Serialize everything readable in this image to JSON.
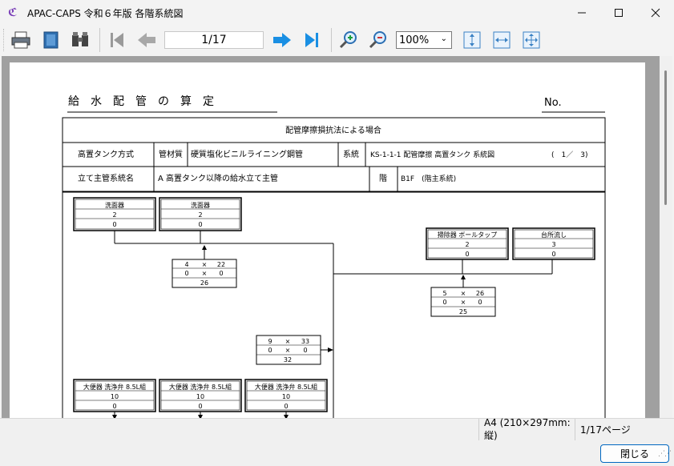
{
  "window": {
    "title": "APAC-CAPS 令和６年版 各階系統図",
    "controls": [
      "minimize-icon",
      "maximize-icon",
      "close-icon"
    ]
  },
  "toolbar": {
    "icons": [
      "print-icon",
      "book-icon",
      "binoculars-icon",
      "first-page-icon",
      "prev-page-icon",
      "next-page-icon",
      "last-page-icon",
      "zoom-in-icon",
      "zoom-out-icon",
      "fit-height-icon",
      "fit-width-icon",
      "fit-page-icon"
    ],
    "page_indicator": "1/17",
    "zoom": "100%"
  },
  "document": {
    "title": "給　水　配　管　の　算　定",
    "no_label": "No.",
    "header_row1": "配管摩擦損抗法による場合",
    "row2": {
      "c1": "高置タンク方式",
      "c2": "管材質",
      "c3": "硬質塩化ビニルライニング鋼管",
      "c4": "系統",
      "c5": "KS-1-1-1 配管摩擦 高置タンク 系統図",
      "c6": "(　1／　3)"
    },
    "row3": {
      "c1": "立て主管系統名",
      "c2": "A 高置タンク以降の給水立て主管",
      "c3": "階",
      "c4": "B1F　(階主系統)"
    }
  },
  "diagram": {
    "fixtures": [
      {
        "name": "洗面器",
        "v1": "2",
        "v2": "0"
      },
      {
        "name": "洗面器",
        "v1": "2",
        "v2": "0"
      },
      {
        "name": "掃除器 ボールタップ",
        "v1": "2",
        "v2": "0"
      },
      {
        "name": "台所流し",
        "v1": "3",
        "v2": "0"
      },
      {
        "name": "大便器 洗浄弁 8.5L組",
        "v1": "10",
        "v2": "0"
      },
      {
        "name": "大便器 洗浄弁 8.5L組",
        "v1": "10",
        "v2": "0"
      },
      {
        "name": "大便器 洗浄弁 8.5L組",
        "v1": "10",
        "v2": "0"
      }
    ],
    "calcs": [
      {
        "a": "4",
        "op": "×",
        "b": "22",
        "c": "0",
        "op2": "×",
        "d": "0",
        "total": "26"
      },
      {
        "a": "5",
        "op": "×",
        "b": "26",
        "c": "0",
        "op2": "×",
        "d": "0",
        "total": "25"
      },
      {
        "a": "9",
        "op": "×",
        "b": "33",
        "c": "0",
        "op2": "×",
        "d": "0",
        "total": "32"
      }
    ]
  },
  "status": {
    "paper": "A4 (210×297mm:縦)",
    "pages": "1/17ページ"
  },
  "footer": {
    "close_label": "閉じる"
  }
}
